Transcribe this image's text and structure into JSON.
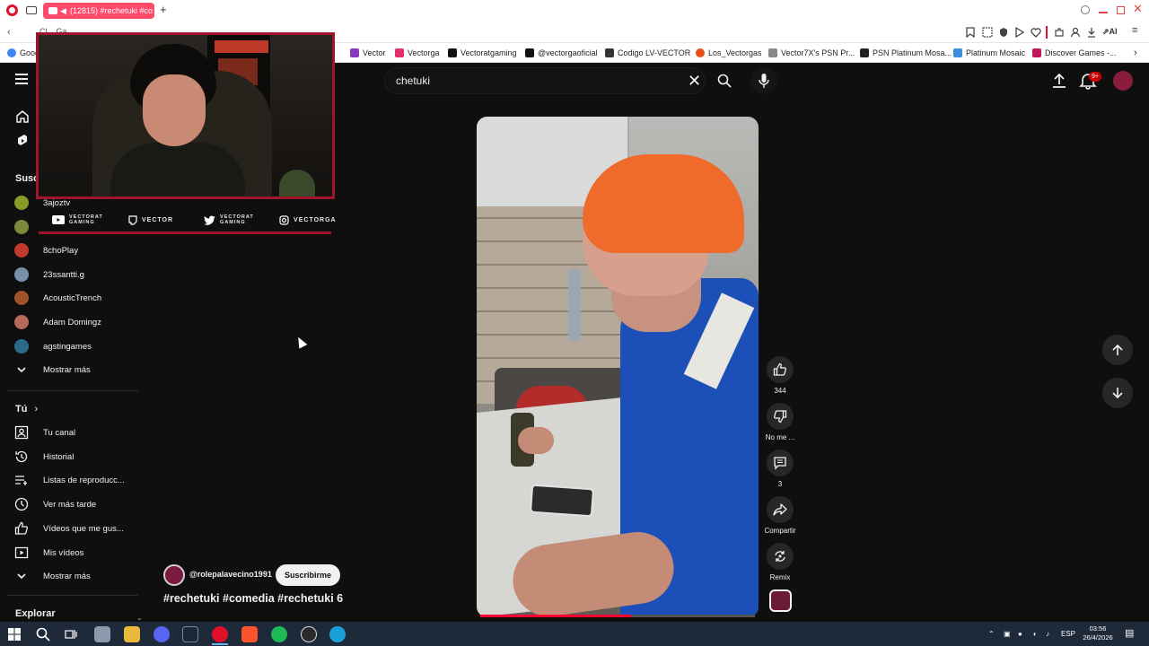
{
  "browser": {
    "active_tab_title": "(12815) #rechetuki #co",
    "address_partial": "Cl... Ga...",
    "bookmarks": [
      {
        "label": "Goog",
        "color": "#4285f4"
      },
      {
        "label": "Vector",
        "color": "#8a3ab9"
      },
      {
        "label": "Vectorga",
        "color": "#e1306c"
      },
      {
        "label": "Vectoratgaming",
        "color": "#111111"
      },
      {
        "label": "@vectorgaoficial",
        "color": "#111111"
      },
      {
        "label": "Codigo LV-VECTOR",
        "color": "#333333"
      },
      {
        "label": "Los_Vectorgas",
        "color": "#e94e1b"
      },
      {
        "label": "Vector7X's PSN Pr...",
        "color": "#888888"
      },
      {
        "label": "PSN Platinum Mosa...",
        "color": "#222222"
      },
      {
        "label": "Platinum Mosaic",
        "color": "#3a8fd9"
      },
      {
        "label": "Discover Games -...",
        "color": "#c2185b"
      }
    ],
    "ai_label": "AI"
  },
  "search": {
    "query": "chetuki"
  },
  "header": {
    "notification_badge": "9+"
  },
  "sidebar": {
    "subscriptions_header": "Susc",
    "subscriptions": [
      {
        "label": "3ajoztv",
        "color": "#8a9a2a"
      },
      {
        "label": "",
        "color": "#7a8a3a"
      },
      {
        "label": "8choPlay",
        "color": "#c0392b"
      },
      {
        "label": "23ssantti.g",
        "color": "#7a90a8"
      },
      {
        "label": "AcousticTrench",
        "color": "#a0522d"
      },
      {
        "label": "Adam Domingz",
        "color": "#b36a5a"
      },
      {
        "label": "agstingames",
        "color": "#2a6a8a"
      }
    ],
    "show_more_1": "Mostrar más",
    "you_header": "Tú",
    "you_items": [
      {
        "label": "Tu canal",
        "icon": "user-icon"
      },
      {
        "label": "Historial",
        "icon": "history-icon"
      },
      {
        "label": "Listas de reproducc...",
        "icon": "playlist-icon"
      },
      {
        "label": "Ver más tarde",
        "icon": "clock-icon"
      },
      {
        "label": "Vídeos que me gus...",
        "icon": "thumbs-up-icon"
      },
      {
        "label": "Mis vídeos",
        "icon": "video-icon"
      }
    ],
    "show_more_2": "Mostrar más",
    "explore_header": "Explorar"
  },
  "overlay": {
    "socials": [
      {
        "label": "VECTORAT GAMING",
        "icon": "youtube-icon"
      },
      {
        "label": "VECTOR",
        "icon": "twitch-icon"
      },
      {
        "label": "VECTORAT GAMING",
        "icon": "twitter-icon"
      },
      {
        "label": "VECTORGA",
        "icon": "instagram-icon"
      }
    ]
  },
  "short": {
    "channel_handle": "@rolepalavecino1991",
    "subscribe_label": "Suscribirme",
    "title": "#rechetuki #comedia #rechetuki  6",
    "progress": 0.55,
    "likes": "344",
    "dislike_label": "No me ...",
    "comments": "3",
    "share_label": "Compartir",
    "remix_label": "Remix"
  },
  "taskbar": {
    "language": "ESP",
    "time": "03:56",
    "date": "26/4/2026"
  }
}
